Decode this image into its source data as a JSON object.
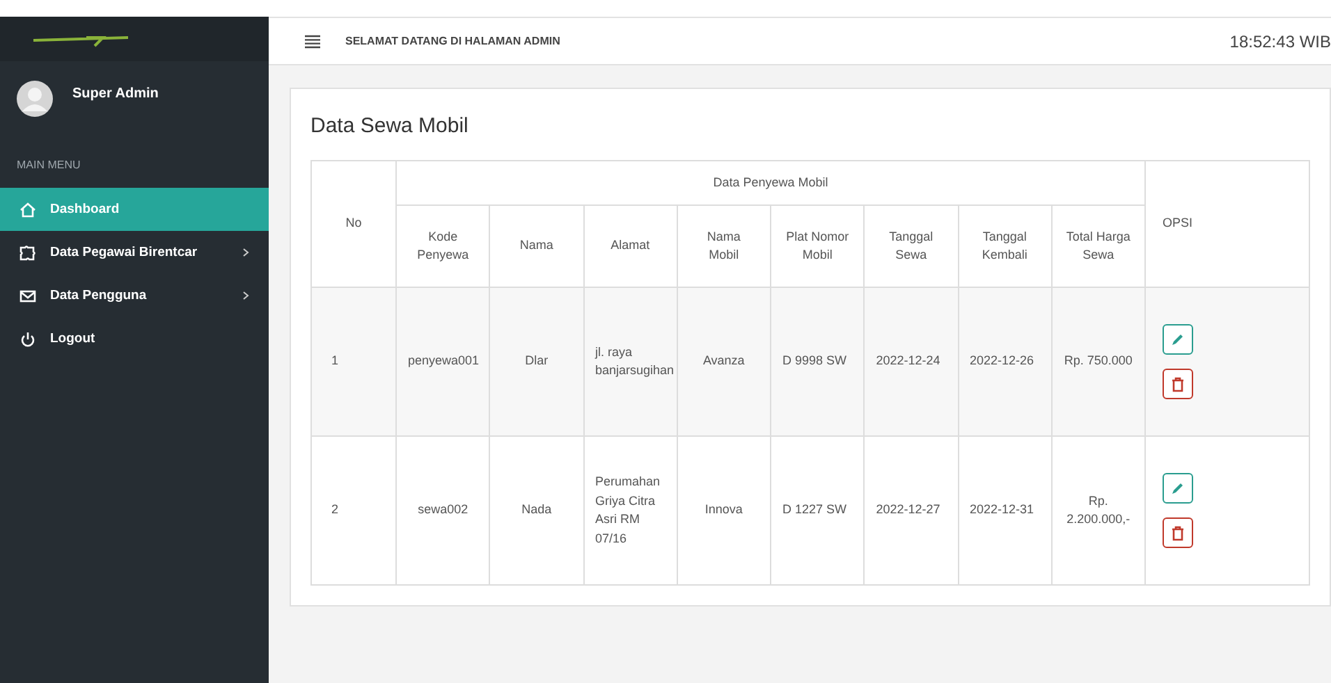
{
  "sidebar": {
    "user": {
      "name": "Super Admin"
    },
    "section_label": "MAIN MENU",
    "items": [
      {
        "label": "Dashboard",
        "kind": "home",
        "selected": true,
        "has_submenu": false
      },
      {
        "label": "Data Pegawai Birentcar",
        "kind": "puzzle",
        "selected": false,
        "has_submenu": true
      },
      {
        "label": "Data Pengguna",
        "kind": "mail",
        "selected": false,
        "has_submenu": true
      },
      {
        "label": "Logout",
        "kind": "power",
        "selected": false,
        "has_submenu": false
      }
    ]
  },
  "topbar": {
    "title": "SELAMAT DATANG DI HALAMAN ADMIN",
    "clock": "18:52:43 WIB"
  },
  "card": {
    "title": "Data Sewa Mobil",
    "table": {
      "no_header": "No",
      "group_header": "Data Penyewa Mobil",
      "options_header": "OPSI",
      "columns": [
        "Kode Penyewa",
        "Nama",
        "Alamat",
        "Nama Mobil",
        "Plat Nomor Mobil",
        "Tanggal Sewa",
        "Tanggal Kembali",
        "Total Harga Sewa"
      ],
      "rows": [
        {
          "no": "1",
          "cells": [
            "penyewa001",
            "Dlar",
            "jl. raya banjarsugihan",
            "Avanza",
            "D 9998 SW",
            "2022-12-24",
            "2022-12-26",
            "Rp. 750.000"
          ]
        },
        {
          "no": "2",
          "cells": [
            "sewa002",
            "Nada",
            "Perumahan Griya Citra Asri RM 07/16",
            "Innova",
            "D 1227 SW",
            "2022-12-27",
            "2022-12-31",
            "Rp. 2.200.000,-"
          ]
        }
      ]
    }
  }
}
